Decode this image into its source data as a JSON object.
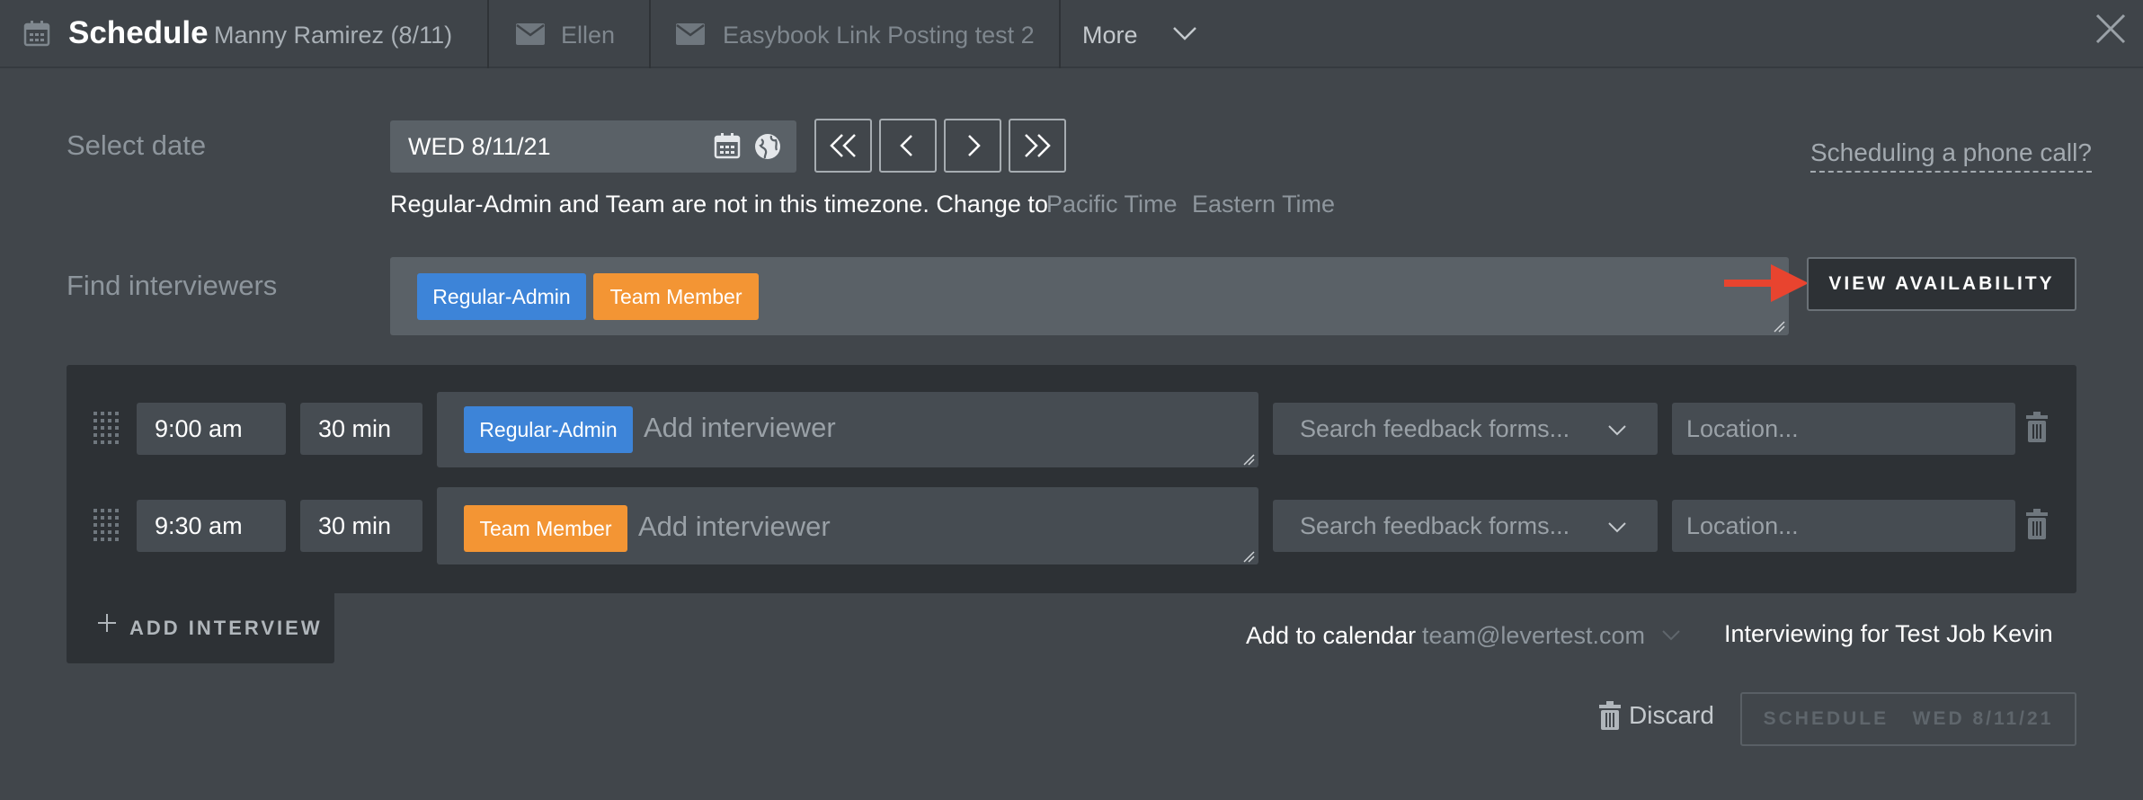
{
  "header": {
    "title": "Schedule",
    "subtitle": "Manny Ramirez (8/11)",
    "tabs": [
      {
        "label": "Ellen",
        "icon": "mail-icon"
      },
      {
        "label": "Easybook Link Posting test 2",
        "icon": "mail-icon"
      }
    ],
    "more_label": "More"
  },
  "date": {
    "label": "Select date",
    "value": "WED 8/11/21",
    "phone_link": "Scheduling a phone call?",
    "tz_note": "Regular-Admin and Team are not in this timezone. Change to",
    "tz_options": [
      "Pacific Time",
      "Eastern Time"
    ]
  },
  "interviewers": {
    "label": "Find interviewers",
    "chips": [
      {
        "label": "Regular-Admin",
        "color": "#3d84d8"
      },
      {
        "label": "Team Member",
        "color": "#f39534"
      }
    ],
    "view_button": "VIEW AVAILABILITY"
  },
  "interviews": [
    {
      "time": "9:00 am",
      "duration": "30 min",
      "interviewer": "Regular-Admin",
      "interviewer_color": "#3d84d8",
      "add_placeholder": "Add interviewer",
      "feedback_placeholder": "Search feedback forms...",
      "location_placeholder": "Location..."
    },
    {
      "time": "9:30 am",
      "duration": "30 min",
      "interviewer": "Team Member",
      "interviewer_color": "#f39534",
      "add_placeholder": "Add interviewer",
      "feedback_placeholder": "Search feedback forms...",
      "location_placeholder": "Location..."
    }
  ],
  "footer": {
    "add_interview": "ADD INTERVIEW",
    "calendar_label": "Add to calendar",
    "calendar_email": "team@levertest.com",
    "job_text": "Interviewing for Test Job Kevin",
    "discard": "Discard",
    "schedule_button": "SCHEDULE   WED 8/11/21"
  },
  "colors": {
    "background": "#41464b",
    "panel": "#2d3135",
    "input": "#5a6167",
    "arrow": "#e8442f"
  }
}
